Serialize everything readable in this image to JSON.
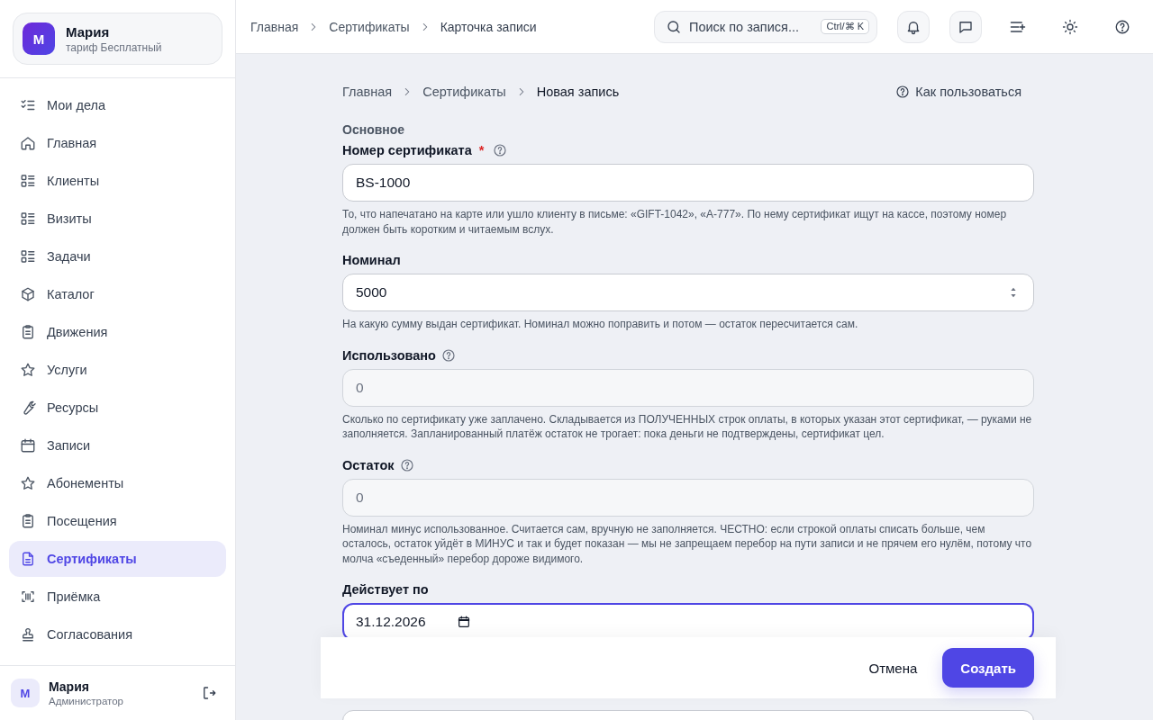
{
  "sidebar": {
    "account": {
      "avatar": "М",
      "name": "Мария",
      "plan": "тариф Бесплатный"
    },
    "items": [
      {
        "label": "Мои дела",
        "selected": false
      },
      {
        "label": "Главная",
        "selected": false
      },
      {
        "label": "Клиенты",
        "selected": false
      },
      {
        "label": "Визиты",
        "selected": false
      },
      {
        "label": "Задачи",
        "selected": false
      },
      {
        "label": "Каталог",
        "selected": false
      },
      {
        "label": "Движения",
        "selected": false
      },
      {
        "label": "Услуги",
        "selected": false
      },
      {
        "label": "Ресурсы",
        "selected": false
      },
      {
        "label": "Записи",
        "selected": false
      },
      {
        "label": "Абонементы",
        "selected": false
      },
      {
        "label": "Посещения",
        "selected": false
      },
      {
        "label": "Сертификаты",
        "selected": true
      },
      {
        "label": "Приёмка",
        "selected": false
      },
      {
        "label": "Согласования",
        "selected": false
      }
    ],
    "user": {
      "avatar": "М",
      "name": "Мария",
      "role": "Администратор"
    }
  },
  "header": {
    "breadcrumbs": [
      "Главная",
      "Сертификаты",
      "Карточка записи"
    ],
    "search": {
      "placeholder": "Поиск по запися...",
      "shortcut": "Ctrl/⌘ K"
    }
  },
  "page": {
    "breadcrumbs": [
      "Главная",
      "Сертификаты",
      "Новая запись"
    ],
    "help_link": "Как пользоваться",
    "section": "Основное",
    "fields": [
      {
        "kind": "text",
        "label": "Номер сертификата",
        "required_mark": "*",
        "help": true,
        "value": "BS-1000",
        "hint": "То, что напечатано на карте или ушло клиенту в письме: «GIFT-1042», «A-777». По нему сертификат ищут на кассе, поэтому номер должен быть коротким и читаемым вслух."
      },
      {
        "kind": "number",
        "label": "Номинал",
        "help": false,
        "value": "5000",
        "hint": "На какую сумму выдан сертификат. Номинал можно поправить и потом — остаток пересчитается сам."
      },
      {
        "kind": "readonly",
        "label": "Использовано",
        "help": true,
        "value": "0",
        "hint": "Сколько по сертификату уже заплачено. Складывается из ПОЛУЧЕННЫХ строк оплаты, в которых указан этот сертификат, — руками не заполняется. Запланированный платёж остаток не трогает: пока деньги не подтверждены, сертификат цел."
      },
      {
        "kind": "readonly",
        "label": "Остаток",
        "help": true,
        "value": "0",
        "hint": "Номинал минус использованное. Считается сам, вручную не заполняется. ЧЕСТНО: если строкой оплаты списать больше, чем осталось, остаток уйдёт в МИНУС и так и будет показан — мы не запрещаем перебор на пути записи и не прячем его нулём, потому что молча «съеденный» перебор дороже видимого."
      },
      {
        "kind": "date",
        "label": "Действует по",
        "help": false,
        "focused": true,
        "value": "31.12.2026"
      },
      {
        "kind": "select",
        "help": false
      }
    ]
  },
  "footer": {
    "cancel": "Отмена",
    "submit": "Создать"
  }
}
